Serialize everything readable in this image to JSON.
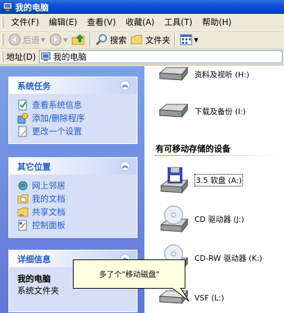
{
  "window": {
    "title": "我的电脑"
  },
  "menu": [
    "文件(F)",
    "编辑(E)",
    "查看(V)",
    "收藏(A)",
    "工具(T)",
    "帮助(H)"
  ],
  "toolbar": {
    "back": "后退",
    "search": "搜索",
    "folders": "文件夹"
  },
  "address": {
    "label": "地址(D)",
    "value": "我的电脑"
  },
  "panels": {
    "system_tasks": {
      "title": "系统任务",
      "items": [
        "查看系统信息",
        "添加/删除程序",
        "更改一个设置"
      ]
    },
    "other_places": {
      "title": "其它位置",
      "items": [
        "网上邻居",
        "我的文档",
        "共享文档",
        "控制面板"
      ]
    },
    "details": {
      "title": "详细信息",
      "name": "我的电脑",
      "type": "系统文件夹"
    }
  },
  "drives": {
    "h": "资料及视听 (H:)",
    "i": "下载及备份 (I:)",
    "group_removable": "有可移动存储的设备",
    "a": "3.5 软盘 (A:)",
    "j": "CD 驱动器 (J:)",
    "k": "CD-RW 驱动器 (K:)",
    "l": "VSF (L:)"
  },
  "callout": {
    "text": "多了个\"移动磁盘\""
  },
  "colors": {
    "title_bar": "#0a4fd6",
    "task_text": "#215dc6",
    "tooltip_bg": "#ffffe1"
  }
}
